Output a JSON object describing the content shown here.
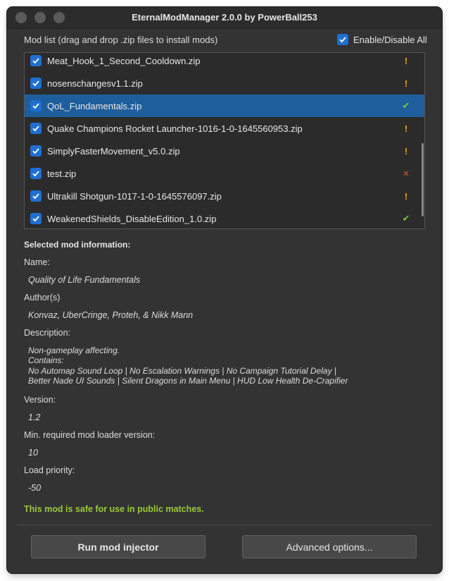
{
  "window": {
    "title": "EternalModManager 2.0.0 by PowerBall253"
  },
  "modlist": {
    "header": "Mod list (drag and drop .zip files to install mods)",
    "enable_all_label": "Enable/Disable All",
    "enable_all_checked": true,
    "items": [
      {
        "name": "Meat_Hook_1_Second_Cooldown.zip",
        "checked": true,
        "status": "warning",
        "status_glyph": "!"
      },
      {
        "name": "nosenschangesv1.1.zip",
        "checked": true,
        "status": "warning",
        "status_glyph": "!"
      },
      {
        "name": "QoL_Fundamentals.zip",
        "checked": true,
        "status": "ok",
        "status_glyph": "✔",
        "selected": true
      },
      {
        "name": "Quake Champions Rocket Launcher-1016-1-0-1645560953.zip",
        "checked": true,
        "status": "warning",
        "status_glyph": "!"
      },
      {
        "name": "SimplyFasterMovement_v5.0.zip",
        "checked": true,
        "status": "warning",
        "status_glyph": "!"
      },
      {
        "name": "test.zip",
        "checked": true,
        "status": "error",
        "status_glyph": "✕"
      },
      {
        "name": "Ultrakill Shotgun-1017-1-0-1645576097.zip",
        "checked": true,
        "status": "warning",
        "status_glyph": "!"
      },
      {
        "name": "WeakenedShields_DisableEdition_1.0.zip",
        "checked": true,
        "status": "ok",
        "status_glyph": "✔"
      }
    ]
  },
  "info": {
    "header": "Selected mod information:",
    "name_label": "Name:",
    "name_value": "Quality of Life Fundamentals",
    "authors_label": "Author(s)",
    "authors_value": "Konvaz, UberCringe, Proteh, & Nikk Mann",
    "description_label": "Description:",
    "description_lines": [
      "Non-gameplay affecting.",
      "Contains:",
      "No Automap Sound Loop | No Escalation Warnings | No Campaign Tutorial Delay |",
      "Better Nade UI Sounds | Silent Dragons in Main Menu | HUD Low Health De-Crapifier"
    ],
    "version_label": "Version:",
    "version_value": "1.2",
    "min_loader_label": "Min. required mod loader version:",
    "min_loader_value": "10",
    "load_priority_label": "Load priority:",
    "load_priority_value": "-50",
    "safe_message": "This mod is safe for use in public matches."
  },
  "buttons": {
    "run_injector": "Run mod injector",
    "advanced_options": "Advanced options..."
  },
  "colors": {
    "accent": "#1f6fd1",
    "selection": "#1e5e9c",
    "warning": "#e8a21c",
    "ok": "#7ac142",
    "error": "#e05a2a",
    "safe_text": "#9ac93a"
  }
}
